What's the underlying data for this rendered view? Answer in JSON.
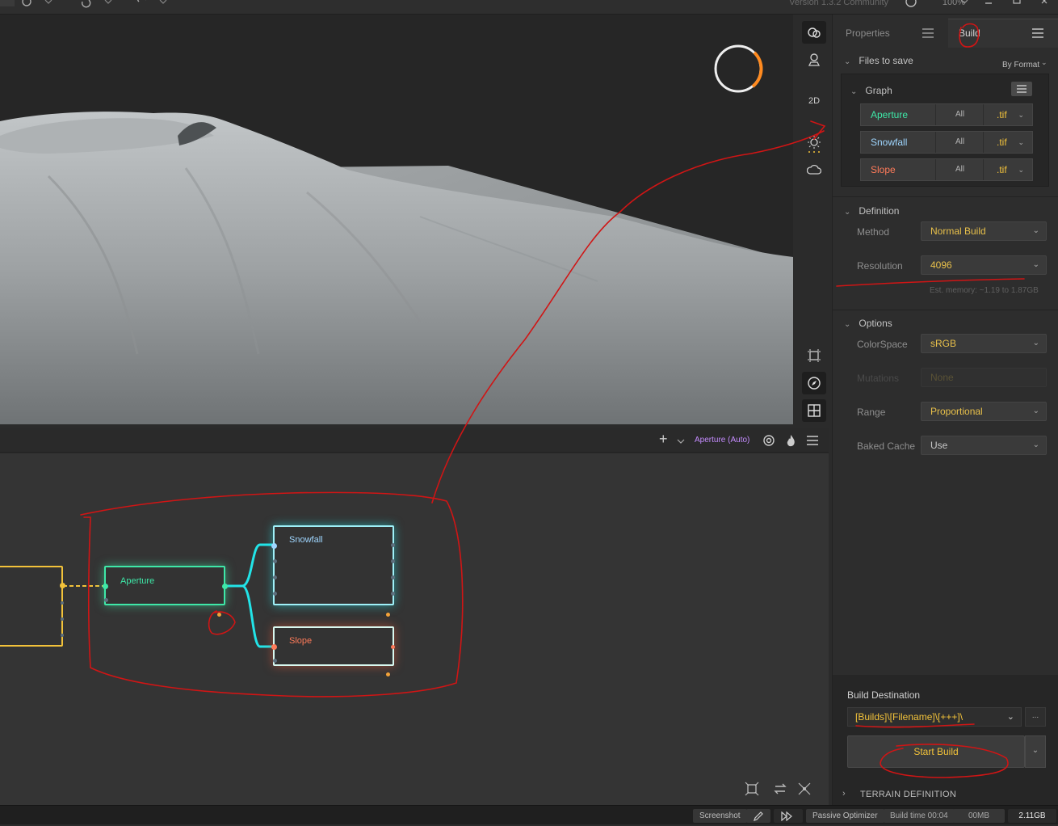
{
  "titlebar": {
    "version": "Version 1.3.2 Community",
    "zoom": "100%"
  },
  "viewport_tools": {
    "mode_2d": "2D"
  },
  "graph_toolbar": {
    "add_label": "+",
    "active_node": "Aperture (Auto)"
  },
  "nodes": {
    "aperture": "Aperture",
    "snowfall": "Snowfall",
    "slope": "Slope"
  },
  "panel": {
    "tabs": {
      "properties": "Properties",
      "build": "Build"
    },
    "files_to_save": {
      "title": "Files to save",
      "sort": "By Format",
      "group": "Graph",
      "rows": [
        {
          "name": "Aperture",
          "all": "All",
          "format": ".tif",
          "color": "#3ee8a8"
        },
        {
          "name": "Snowfall",
          "all": "All",
          "format": ".tif",
          "color": "#9fd6ff"
        },
        {
          "name": "Slope",
          "all": "All",
          "format": ".tif",
          "color": "#ff7b5a"
        }
      ]
    },
    "definition": {
      "title": "Definition",
      "method_label": "Method",
      "method_value": "Normal Build",
      "resolution_label": "Resolution",
      "resolution_value": "4096",
      "memory_note": "Est. memory: ~1.19 to 1.87GB"
    },
    "options": {
      "title": "Options",
      "colorspace_label": "ColorSpace",
      "colorspace_value": "sRGB",
      "mutations_label": "Mutations",
      "mutations_value": "None",
      "range_label": "Range",
      "range_value": "Proportional",
      "baked_label": "Baked Cache",
      "baked_value": "Use"
    },
    "build_destination": {
      "title": "Build Destination",
      "path": "[Builds]\\[Filename]\\[+++]\\",
      "browse": "...",
      "start": "Start Build"
    },
    "terrain_definition": "TERRAIN DEFINITION"
  },
  "statusbar": {
    "screenshot": "Screenshot",
    "optimizer": "Passive Optimizer",
    "build_time": "Build time 00:04",
    "mem1": "00MB",
    "mem2": "2.11GB"
  },
  "colors": {
    "accent_yellow": "#f2c23a",
    "aperture": "#3ee8a8",
    "snowfall_wire": "#22e4e8",
    "slope": "#ff7b5a",
    "annotation_red": "#d01515"
  }
}
